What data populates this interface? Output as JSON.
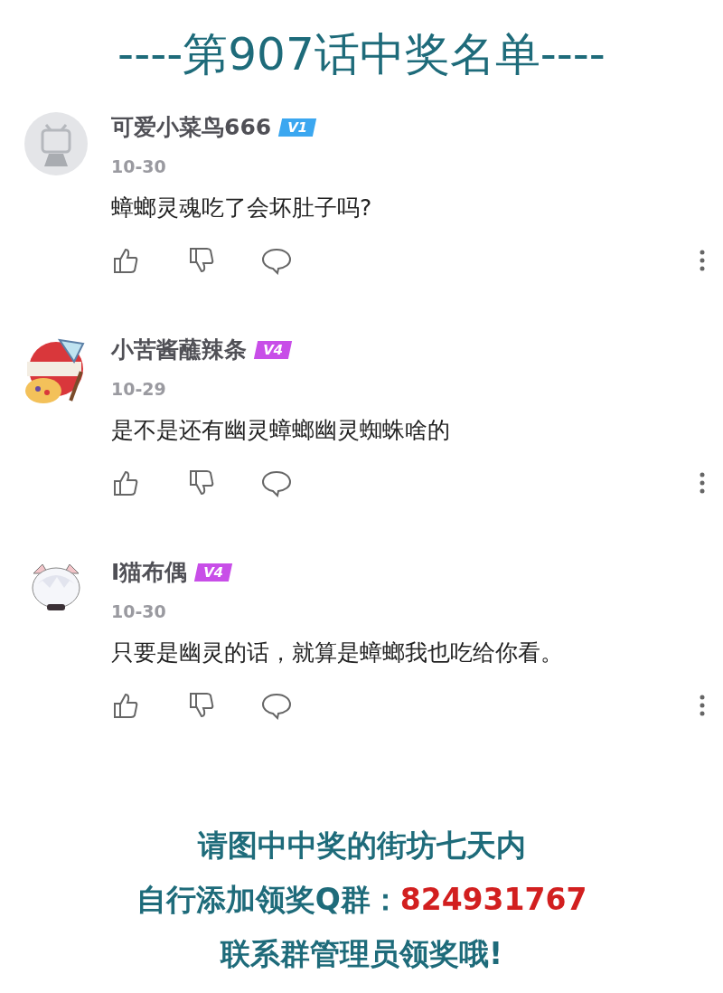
{
  "title": "----第907话中奖名单----",
  "comments": [
    {
      "user": "可爱小菜鸟666",
      "badge": "V1",
      "color": "#3ba7f0",
      "date": "10-30",
      "text": "蟑螂灵魂吃了会坏肚子吗?"
    },
    {
      "user": "小苦酱蘸辣条",
      "badge": "V4",
      "color": "#c84ee8",
      "date": "10-29",
      "text": "是不是还有幽灵蟑螂幽灵蜘蛛啥的"
    },
    {
      "user": "I猫布偶",
      "badge": "V4",
      "color": "#c84ee8",
      "date": "10-30",
      "text": "只要是幽灵的话，就算是蟑螂我也吃给你看。"
    }
  ],
  "notice": {
    "line1": "请图中中奖的街坊七天内",
    "line2_label": "自行添加领奖Q群：",
    "line2_number": "824931767",
    "line3": "联系群管理员领奖哦!"
  }
}
